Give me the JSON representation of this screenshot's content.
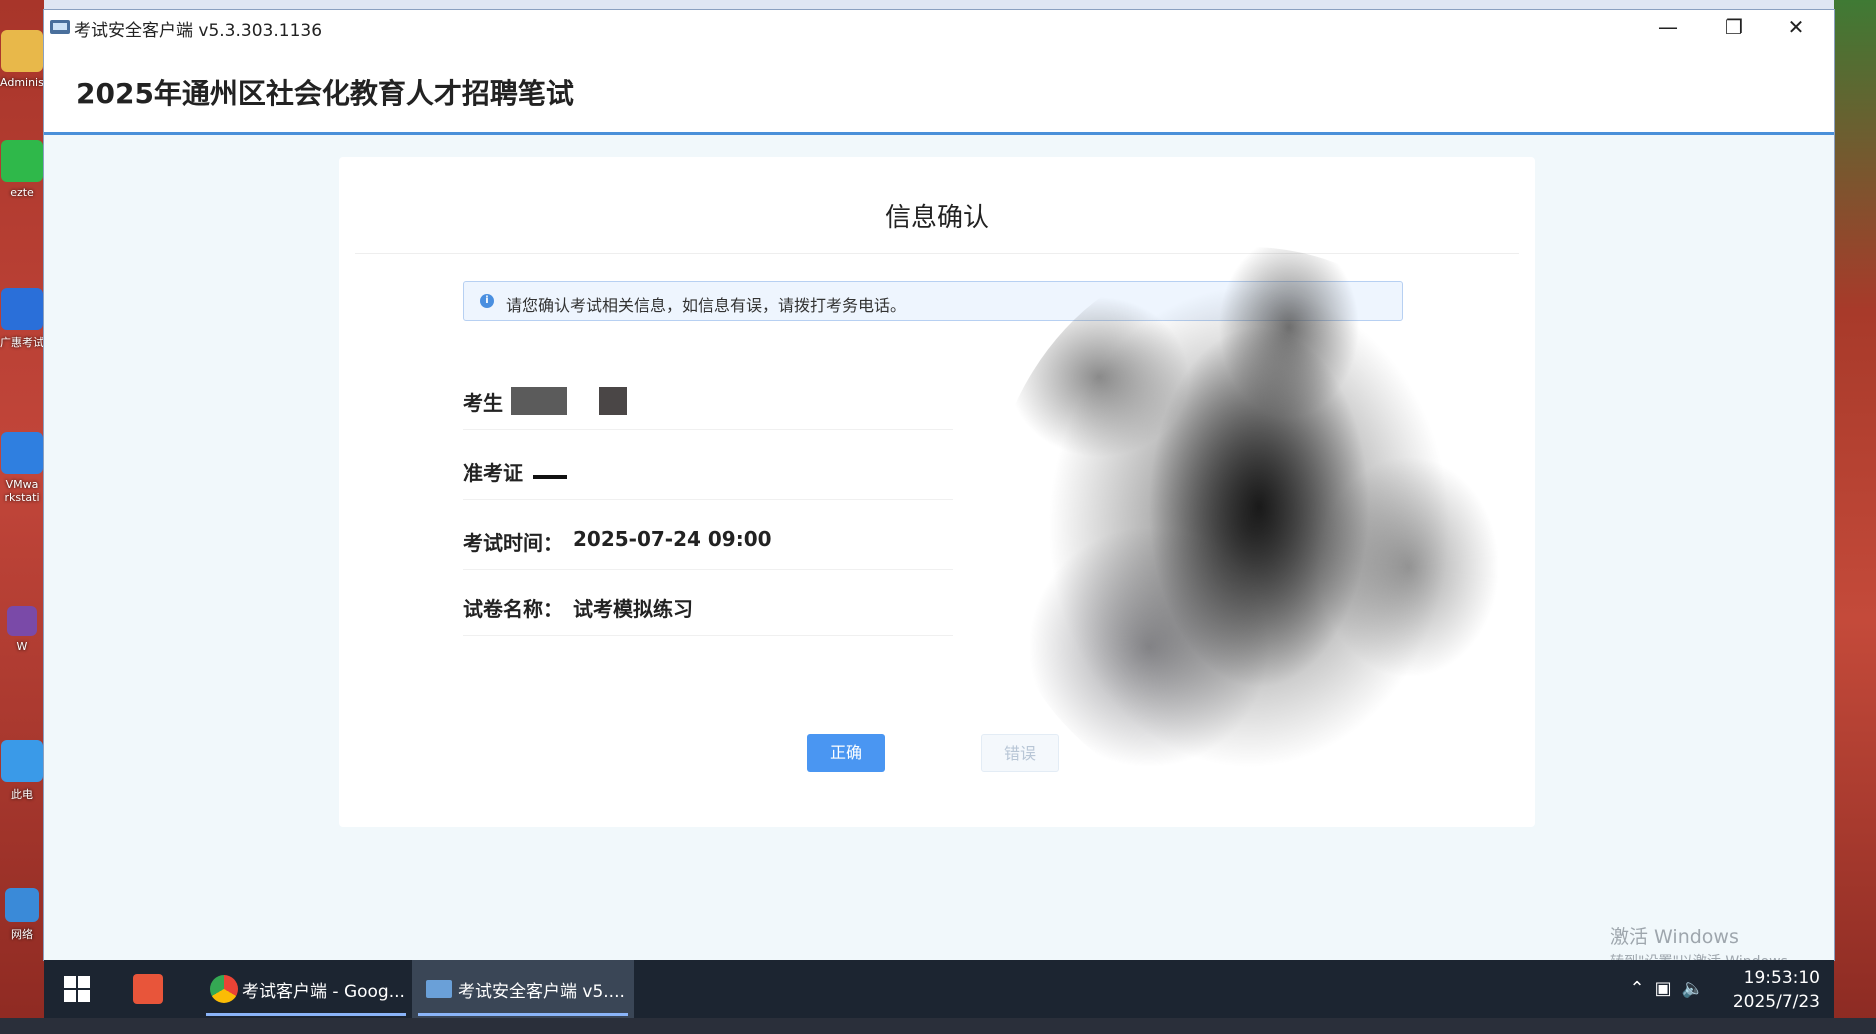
{
  "window": {
    "title": "考试安全客户端 v5.3.303.1136"
  },
  "header": {
    "exam_title": "2025年通州区社会化教育人才招聘笔试"
  },
  "card": {
    "title": "信息确认",
    "notice": "请您确认考试相关信息，如信息有误，请拨打考务电话。",
    "fields": [
      {
        "label": "考生",
        "value": ""
      },
      {
        "label": "准考证",
        "value": ""
      },
      {
        "label": "考试时间：",
        "value": "2025-07-24 09:00"
      },
      {
        "label": "试卷名称：",
        "value": "试考模拟练习"
      }
    ],
    "confirm_button": "正确",
    "error_button": "错误"
  },
  "watermark": {
    "line1": "激活 Windows",
    "line2": "转到\"设置\"以激活 Windows。"
  },
  "taskbar": {
    "items": [
      {
        "label": "考试客户端 - Goog..."
      },
      {
        "label": "考试安全客户端 v5...."
      }
    ],
    "time": "19:53:10",
    "date": "2025/7/23"
  },
  "desktop": {
    "icons": [
      {
        "label": "Administ"
      },
      {
        "label": "ezte"
      },
      {
        "label": "广惠考试"
      },
      {
        "label": "VMwa rkstati"
      },
      {
        "label": "W"
      },
      {
        "label": "此电"
      },
      {
        "label": "网络"
      }
    ]
  }
}
